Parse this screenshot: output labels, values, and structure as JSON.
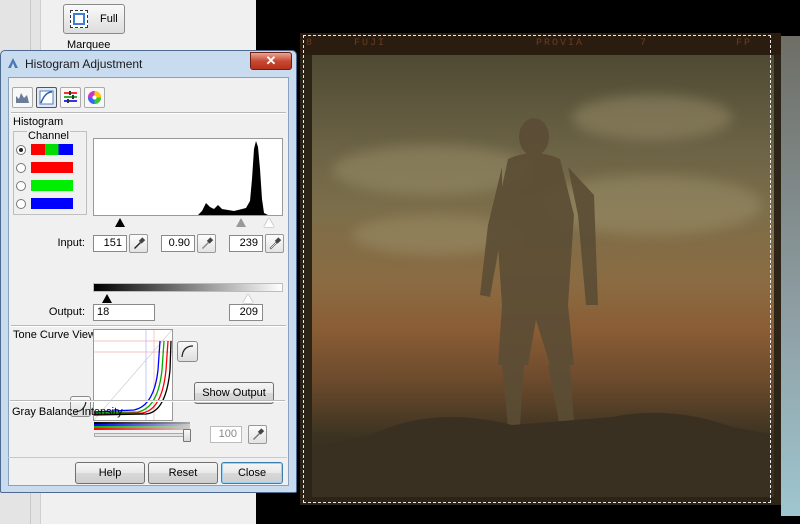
{
  "background_window": {
    "full_button_label": "Full",
    "marquee_label": "Marquee"
  },
  "preview": {
    "film_edge_codes": [
      "8",
      "FUJI",
      "PROVIA",
      "7",
      "FP"
    ]
  },
  "dialog": {
    "title": "Histogram Adjustment",
    "close_symbol": "✕",
    "toolbar_icons": [
      "histogram-icon",
      "tone-curve-icon",
      "color-balance-icon",
      "color-wheel-icon"
    ],
    "histogram": {
      "section_label": "Histogram",
      "channel_label": "Channel",
      "channels": [
        {
          "name": "rgb",
          "colors": [
            "#ff0000",
            "#00dd00",
            "#0000ff"
          ],
          "selected": true
        },
        {
          "name": "red",
          "colors": [
            "#ff0000"
          ],
          "selected": false
        },
        {
          "name": "green",
          "colors": [
            "#00ee00"
          ],
          "selected": false
        },
        {
          "name": "blue",
          "colors": [
            "#0000ff"
          ],
          "selected": false
        }
      ],
      "input_label": "Input:",
      "input_shadow": "151",
      "input_gamma": "0.90",
      "input_highlight": "239",
      "output_label": "Output:",
      "output_shadow": "18",
      "output_highlight": "209"
    },
    "tone_curve": {
      "section_label": "Tone Curve Viewer",
      "show_output_label": "Show Output"
    },
    "gray_balance": {
      "section_label": "Gray Balance Intensity",
      "value": "100",
      "slider_level_percent": 100
    },
    "buttons": {
      "help": "Help",
      "reset": "Reset",
      "close": "Close"
    }
  }
}
